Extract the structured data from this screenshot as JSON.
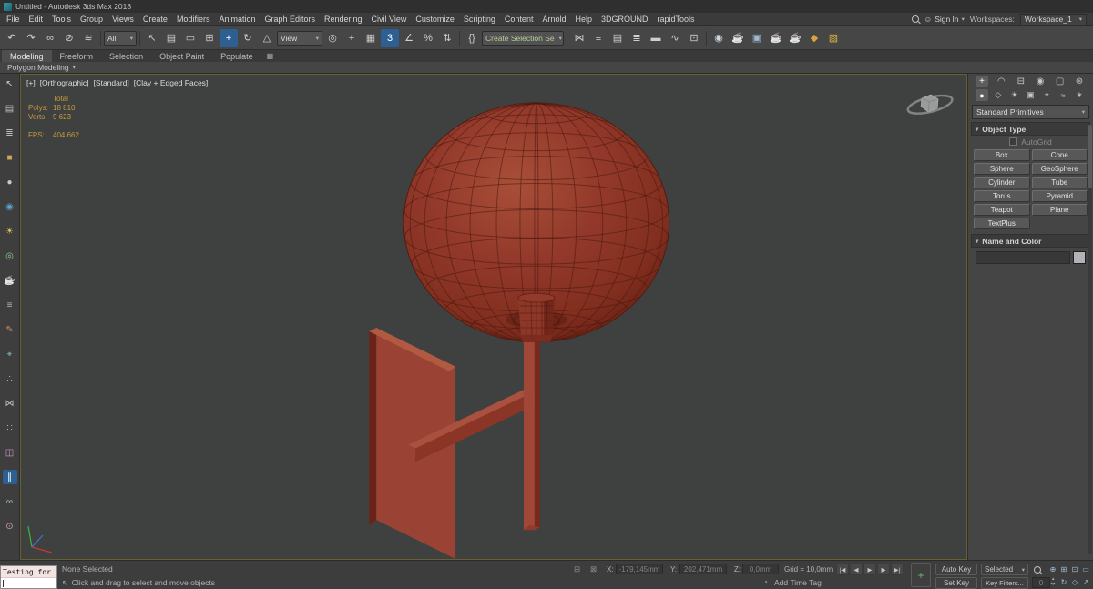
{
  "window": {
    "title": "Untitled - Autodesk 3ds Max 2018"
  },
  "glyphs": {
    "chevron": "▾",
    "user": "☺",
    "lock": "⊠",
    "gizmo": "⊞",
    "time_tag": "◔",
    "prompt_cursor": "↖",
    "spinner_up": "▴",
    "spinner_down": "▾"
  },
  "menu": {
    "items": [
      "File",
      "Edit",
      "Tools",
      "Group",
      "Views",
      "Create",
      "Modifiers",
      "Animation",
      "Graph Editors",
      "Rendering",
      "Civil View",
      "Customize",
      "Scripting",
      "Content",
      "Arnold",
      "Help",
      "3DGROUND",
      "rapidTools"
    ]
  },
  "account": {
    "sign_in": "Sign In",
    "workspaces_label": "Workspaces:",
    "workspace_value": "Workspace_1"
  },
  "toolbar": {
    "filter_value": "All",
    "view_value": "View",
    "named_set_value": "Create Selection Se",
    "group_a": [
      {
        "name": "undo-icon",
        "glyph": "↶"
      },
      {
        "name": "redo-icon",
        "glyph": "↷"
      },
      {
        "name": "select-and-link-icon",
        "glyph": "∞"
      },
      {
        "name": "unlink-selection-icon",
        "glyph": "⊘"
      },
      {
        "name": "bind-to-space-warp-icon",
        "glyph": "≋"
      }
    ],
    "group_b": [
      {
        "name": "select-object-icon",
        "glyph": "↖"
      },
      {
        "name": "select-by-name-icon",
        "glyph": "▤"
      },
      {
        "name": "rectangular-selection-region-icon",
        "glyph": "▭"
      },
      {
        "name": "window-crossing-toggle-icon",
        "glyph": "⊞"
      },
      {
        "name": "select-and-move-icon",
        "glyph": "+",
        "color": "#ffffff",
        "bg": "#2e5f93"
      },
      {
        "name": "select-and-rotate-icon",
        "glyph": "↻"
      },
      {
        "name": "select-and-scale-icon",
        "glyph": "△"
      }
    ],
    "group_c": [
      {
        "name": "use-pivot-point-center-icon",
        "glyph": "◎"
      },
      {
        "name": "select-and-manipulate-icon",
        "glyph": "+"
      },
      {
        "name": "keyboard-shortcut-override-icon",
        "glyph": "▦"
      },
      {
        "name": "snaps-toggle-icon",
        "glyph": "3",
        "color": "#ffffff",
        "bg": "#2e5f93"
      },
      {
        "name": "angle-snap-toggle-icon",
        "glyph": "∠"
      },
      {
        "name": "percent-snap-toggle-icon",
        "glyph": "%"
      },
      {
        "name": "spinner-snap-toggle-icon",
        "glyph": "⇅"
      }
    ],
    "group_d": [
      {
        "name": "edit-named-selection-sets-icon",
        "glyph": "{}"
      }
    ],
    "group_e": [
      {
        "name": "mirror-icon",
        "glyph": "⋈"
      },
      {
        "name": "align-icon",
        "glyph": "≡"
      },
      {
        "name": "toggle-scene-explorer-icon",
        "glyph": "▤"
      },
      {
        "name": "toggle-layer-explorer-icon",
        "glyph": "≣"
      },
      {
        "name": "toggle-ribbon-icon",
        "glyph": "▬"
      },
      {
        "name": "curve-editor-icon",
        "glyph": "∿"
      },
      {
        "name": "schematic-view-icon",
        "glyph": "⊡"
      }
    ],
    "group_f": [
      {
        "name": "material-editor-icon",
        "glyph": "◉",
        "color": "#cdd6de"
      },
      {
        "name": "render-setup-icon",
        "glyph": "☕",
        "color": "#c3ccd4"
      },
      {
        "name": "rendered-frame-window-icon",
        "glyph": "▣",
        "color": "#9fb9d0"
      },
      {
        "name": "render-production-icon",
        "glyph": "☕",
        "color": "#7fb2d9"
      },
      {
        "name": "render-iterative-icon",
        "glyph": "☕",
        "color": "#66a7d6"
      },
      {
        "name": "arnold-render-icon",
        "glyph": "◆",
        "color": "#d8a33e"
      },
      {
        "name": "scene-converter-icon",
        "glyph": "▨",
        "color": "#d9b43f"
      }
    ]
  },
  "ribbon": {
    "tabs": [
      {
        "label": "Modeling",
        "bg": "#4f4f4f",
        "color": "#e9e9e9"
      },
      {
        "label": "Freeform"
      },
      {
        "label": "Selection"
      },
      {
        "label": "Object Paint"
      },
      {
        "label": "Populate"
      }
    ],
    "config_glyph": "▦",
    "subtab": "Polygon Modeling"
  },
  "left_toolbar": {
    "icons": [
      {
        "name": "select-cursor-icon",
        "glyph": "↖",
        "color": "#cfcfcf"
      },
      {
        "name": "scene-explorer-icon",
        "glyph": "▤",
        "color": "#bdbdbd"
      },
      {
        "name": "layer-manager-icon",
        "glyph": "≣",
        "color": "#bdbdbd"
      },
      {
        "name": "geometry-box-icon",
        "glyph": "■",
        "color": "#cfa558"
      },
      {
        "name": "geometry-sphere-icon",
        "glyph": "●",
        "color": "#c9c9c9"
      },
      {
        "name": "material-sample-icon",
        "glyph": "◉",
        "color": "#5f9fca"
      },
      {
        "name": "light-tool-icon",
        "glyph": "☀",
        "color": "#e0c25a"
      },
      {
        "name": "camera-tool-icon",
        "glyph": "◎",
        "color": "#8cc98c"
      },
      {
        "name": "render-teapot-icon",
        "glyph": "☕",
        "color": "#cf7a58"
      },
      {
        "name": "script-listener-icon",
        "glyph": "≡",
        "color": "#b5b5b5"
      },
      {
        "name": "paint-brush-icon",
        "glyph": "✎",
        "color": "#d08a64"
      },
      {
        "name": "measure-tape-icon",
        "glyph": "⌖",
        "color": "#84c6cf"
      },
      {
        "name": "spacing-tool-icon",
        "glyph": "∴",
        "color": "#a9a9d6"
      },
      {
        "name": "mirror-modifier-icon",
        "glyph": "⋈",
        "color": "#c4c4c4"
      },
      {
        "name": "array-tool-icon",
        "glyph": "∷",
        "color": "#96cb96"
      },
      {
        "name": "snapshot-tool-icon",
        "glyph": "◫",
        "color": "#cf96cf"
      },
      {
        "name": "align-objects-icon",
        "glyph": "∥",
        "color": "#ffffff",
        "bg": "#2e5f93"
      },
      {
        "name": "link-hierarchy-icon",
        "glyph": "∞",
        "color": "#9fc0cf"
      },
      {
        "name": "isolate-selection-icon",
        "glyph": "⊙",
        "color": "#cf9f9f"
      }
    ]
  },
  "viewport": {
    "label_segments": [
      "[+]",
      "[Orthographic]",
      "[Standard]",
      "[Clay + Edged Faces]"
    ],
    "stats": {
      "rows": [
        {
          "label": "",
          "value": "Total"
        },
        {
          "label": "Polys:",
          "value": "18 810"
        },
        {
          "label": "Verts:",
          "value": "9 623"
        }
      ],
      "fps_label": "FPS:",
      "fps_value": "404,662"
    },
    "colors": {
      "background": "#3f4040",
      "object_base": "#93392b",
      "object_highlight": "#a84f38",
      "object_shadow": "#6a2115",
      "wireframe": "#4a180e",
      "panel_front": "#9a4334",
      "panel_edge": "#6b2218",
      "panel_top": "#b05a42",
      "stem_light": "#a04737",
      "stem_dark": "#77291d",
      "arm_top": "#a9513e",
      "arm_front": "#8a3526",
      "stats_text": "#c89a3c",
      "active_border": "#6a5f2e"
    }
  },
  "command_panel": {
    "tabs": [
      {
        "name": "create-tab-icon",
        "glyph": "+",
        "bg": "#5d5d5d",
        "color": "#ffffff"
      },
      {
        "name": "modify-tab-icon",
        "glyph": "◠"
      },
      {
        "name": "hierarchy-tab-icon",
        "glyph": "⊟"
      },
      {
        "name": "motion-tab-icon",
        "glyph": "◉"
      },
      {
        "name": "display-tab-icon",
        "glyph": "▢"
      },
      {
        "name": "utilities-tab-icon",
        "glyph": "⊛"
      }
    ],
    "categories": [
      {
        "name": "geometry-category-icon",
        "glyph": "●",
        "bg": "#5d5d5d",
        "color": "#ffffff"
      },
      {
        "name": "shapes-category-icon",
        "glyph": "◇"
      },
      {
        "name": "lights-category-icon",
        "glyph": "☀"
      },
      {
        "name": "cameras-category-icon",
        "glyph": "▣"
      },
      {
        "name": "helpers-category-icon",
        "glyph": "⌖"
      },
      {
        "name": "space-warps-category-icon",
        "glyph": "≈"
      },
      {
        "name": "systems-category-icon",
        "glyph": "∗"
      }
    ],
    "primitive_dropdown": "Standard Primitives",
    "object_type_rollout": "Object Type",
    "autogrid_label": "AutoGrid",
    "primitives": [
      "Box",
      "Cone",
      "Sphere",
      "GeoSphere",
      "Cylinder",
      "Tube",
      "Torus",
      "Pyramid",
      "Teapot",
      "Plane",
      "TextPlus"
    ],
    "name_color_rollout": "Name and Color"
  },
  "status": {
    "selection": "None Selected",
    "prompt": "Click and drag to select and move objects",
    "x_label": "X:",
    "x_value": "-179,145mm",
    "y_label": "Y:",
    "y_value": "202,471mm",
    "z_label": "Z:",
    "z_value": "0,0mm",
    "grid": "Grid = 10,0mm",
    "add_time_tag": "Add Time Tag",
    "auto_key": "Auto Key",
    "set_key": "Set Key",
    "selected_dropdown": "Selected",
    "key_filters": "Key Filters...",
    "frame": "0",
    "transport": [
      {
        "name": "go-to-start-icon",
        "glyph": "|◀"
      },
      {
        "name": "previous-frame-icon",
        "glyph": "◀"
      },
      {
        "name": "play-animation-icon",
        "glyph": "▶"
      },
      {
        "name": "next-frame-icon",
        "glyph": "▶"
      },
      {
        "name": "go-to-end-icon",
        "glyph": "▶|"
      }
    ],
    "corner_nav": [
      {
        "name": "zoom-icon",
        "glyph": "⊕"
      },
      {
        "name": "zoom-all-icon",
        "glyph": "⊞"
      },
      {
        "name": "zoom-extents-icon",
        "glyph": "⊡"
      },
      {
        "name": "zoom-region-icon",
        "glyph": "▭"
      },
      {
        "name": "pan-view-icon",
        "glyph": "↔"
      },
      {
        "name": "orbit-view-icon",
        "glyph": "↻"
      },
      {
        "name": "field-of-view-icon",
        "glyph": "◇"
      },
      {
        "name": "maximize-viewport-icon",
        "glyph": "↗"
      }
    ]
  },
  "listener": {
    "line1": "Testing for"
  }
}
